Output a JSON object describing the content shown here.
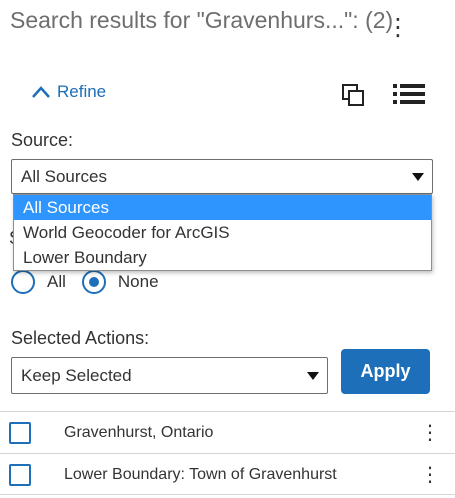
{
  "header": {
    "title": "Search results for \"Gravenhurs...\": (2)"
  },
  "toolbar": {
    "refine_label": "Refine",
    "icons": [
      "chevron-up-icon",
      "copy-icon",
      "list-icon",
      "more-vertical-icon"
    ]
  },
  "source": {
    "label": "Source:",
    "selected": "All Sources",
    "options": [
      "All Sources",
      "World Geocoder for ArcGIS",
      "Lower Boundary"
    ],
    "highlighted_index": 0
  },
  "selection_mode": {
    "options": [
      {
        "label": "All",
        "checked": false
      },
      {
        "label": "None",
        "checked": true
      }
    ]
  },
  "actions": {
    "label": "Selected Actions:",
    "selected": "Keep Selected",
    "apply_label": "Apply"
  },
  "results": [
    {
      "label": "Gravenhurst, Ontario",
      "checked": false
    },
    {
      "label": "Lower Boundary: Town of Gravenhurst",
      "checked": false
    }
  ],
  "colors": {
    "accent": "#1c6fb8",
    "highlight": "#2e95ff",
    "title_gray": "#6e6e6e"
  }
}
